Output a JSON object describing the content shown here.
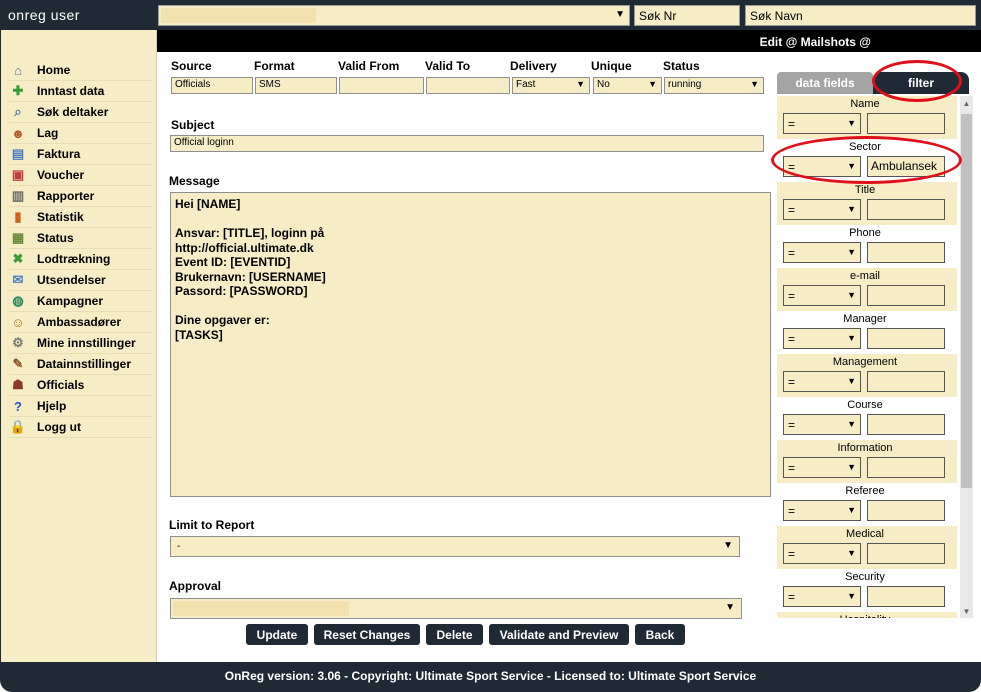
{
  "topbar": {
    "app_title": "onreg user",
    "search_nr_placeholder": "Søk Nr",
    "search_name_placeholder": "Søk Navn"
  },
  "sidebar": {
    "items": [
      {
        "label": "Home",
        "icon": "home-icon"
      },
      {
        "label": "Inntast data",
        "icon": "add-user-icon"
      },
      {
        "label": "Søk deltaker",
        "icon": "search-icon"
      },
      {
        "label": "Lag",
        "icon": "team-icon"
      },
      {
        "label": "Faktura",
        "icon": "invoice-icon"
      },
      {
        "label": "Voucher",
        "icon": "gift-icon"
      },
      {
        "label": "Rapporter",
        "icon": "report-icon"
      },
      {
        "label": "Statistik",
        "icon": "bar-chart-icon"
      },
      {
        "label": "Status",
        "icon": "status-icon"
      },
      {
        "label": "Lodtrækning",
        "icon": "lottery-icon"
      },
      {
        "label": "Utsendelser",
        "icon": "mail-icon"
      },
      {
        "label": "Kampagner",
        "icon": "globe-icon"
      },
      {
        "label": "Ambassadører",
        "icon": "ambassador-icon"
      },
      {
        "label": "Mine innstillinger",
        "icon": "gear-icon"
      },
      {
        "label": "Datainnstillinger",
        "icon": "tools-icon"
      },
      {
        "label": "Officials",
        "icon": "officials-icon"
      },
      {
        "label": "Hjelp",
        "icon": "help-icon"
      },
      {
        "label": "Logg ut",
        "icon": "lock-icon"
      }
    ]
  },
  "header": {
    "title": "Edit @ Mailshots @"
  },
  "form": {
    "labels": {
      "source": "Source",
      "format": "Format",
      "valid_from": "Valid From",
      "valid_to": "Valid To",
      "delivery": "Delivery",
      "unique": "Unique",
      "status": "Status",
      "subject": "Subject",
      "message": "Message",
      "limit": "Limit to Report",
      "approval": "Approval"
    },
    "values": {
      "source": "Officials",
      "format": "SMS",
      "valid_from": "",
      "valid_to": "",
      "delivery": "Fast",
      "unique": "No",
      "status": "running",
      "subject": "Official loginn",
      "message": "Hei [NAME]\n\nAnsvar: [TITLE], loginn på\nhttp://official.ultimate.dk\nEvent ID: [EVENTID]\nBrukernavn: [USERNAME]\nPassord: [PASSWORD]\n\nDine opgaver er:\n[TASKS]",
      "limit": "-"
    }
  },
  "buttons": {
    "update": "Update",
    "reset": "Reset Changes",
    "delete": "Delete",
    "validate": "Validate and Preview",
    "back": "Back"
  },
  "panel": {
    "tab_fields": "data fields",
    "tab_filter": "filter",
    "filters": [
      {
        "name": "Name",
        "op": "=",
        "value": ""
      },
      {
        "name": "Sector",
        "op": "=",
        "value": "Ambulansek"
      },
      {
        "name": "Title",
        "op": "=",
        "value": ""
      },
      {
        "name": "Phone",
        "op": "=",
        "value": ""
      },
      {
        "name": "e-mail",
        "op": "=",
        "value": ""
      },
      {
        "name": "Manager",
        "op": "=",
        "value": ""
      },
      {
        "name": "Management",
        "op": "=",
        "value": ""
      },
      {
        "name": "Course",
        "op": "=",
        "value": ""
      },
      {
        "name": "Information",
        "op": "=",
        "value": ""
      },
      {
        "name": "Referee",
        "op": "=",
        "value": ""
      },
      {
        "name": "Medical",
        "op": "=",
        "value": ""
      },
      {
        "name": "Security",
        "op": "=",
        "value": ""
      },
      {
        "name": "Hospitality",
        "op": "=",
        "value": ""
      }
    ]
  },
  "footer": {
    "text": "OnReg version: 3.06 - Copyright: Ultimate Sport Service - Licensed to: Ultimate Sport Service"
  },
  "colors": {
    "dark": "#1f2a35",
    "field": "#f6ecc6",
    "annotation": "#e0101a"
  }
}
